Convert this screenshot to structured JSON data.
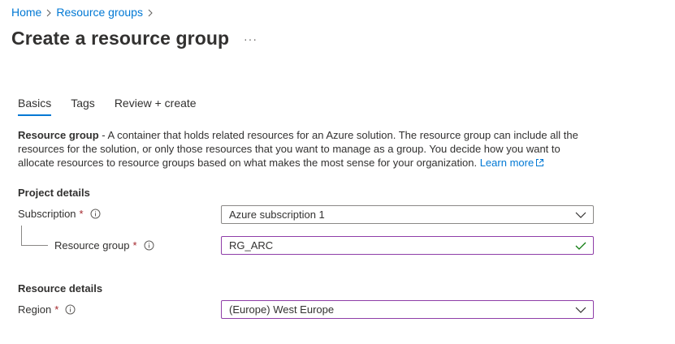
{
  "breadcrumb": {
    "home": "Home",
    "resource_groups": "Resource groups"
  },
  "page": {
    "title": "Create a resource group",
    "more": "···"
  },
  "tabs": [
    {
      "label": "Basics"
    },
    {
      "label": "Tags"
    },
    {
      "label": "Review + create"
    }
  ],
  "description": {
    "bold": "Resource group",
    "text": " - A container that holds related resources for an Azure solution. The resource group can include all the resources for the solution, or only those resources that you want to manage as a group. You decide how you want to allocate resources to resource groups based on what makes the most sense for your organization. ",
    "link": "Learn more"
  },
  "project_details": {
    "title": "Project details",
    "subscription": {
      "label": "Subscription",
      "required": "*",
      "value": "Azure subscription 1"
    },
    "resource_group": {
      "label": "Resource group",
      "required": "*",
      "value": "RG_ARC"
    }
  },
  "resource_details": {
    "title": "Resource details",
    "region": {
      "label": "Region",
      "required": "*",
      "value": "(Europe) West Europe"
    }
  },
  "colors": {
    "accent": "#0078d4",
    "required": "#a4262c",
    "valid": "#107c10",
    "focus": "#8f3ea8"
  }
}
